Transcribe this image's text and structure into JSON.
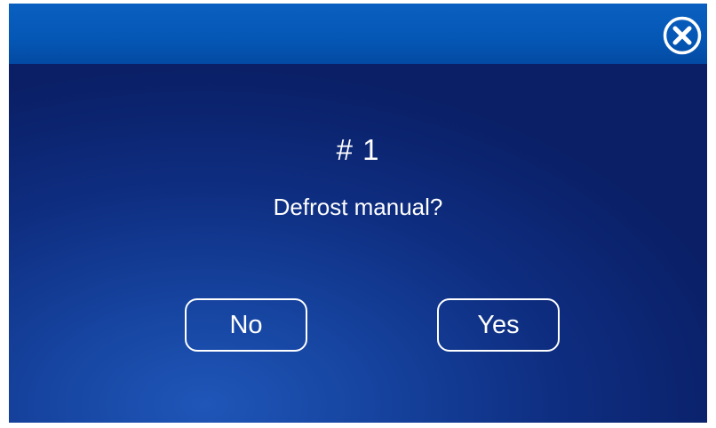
{
  "header": {
    "close_icon": "close-circle-x-icon"
  },
  "dialog": {
    "number": "# 1",
    "question": "Defrost manual?",
    "no_label": "No",
    "yes_label": "Yes"
  },
  "colors": {
    "titlebar": "#0557b5",
    "background": "#0e2d80",
    "text": "#ffffff"
  }
}
